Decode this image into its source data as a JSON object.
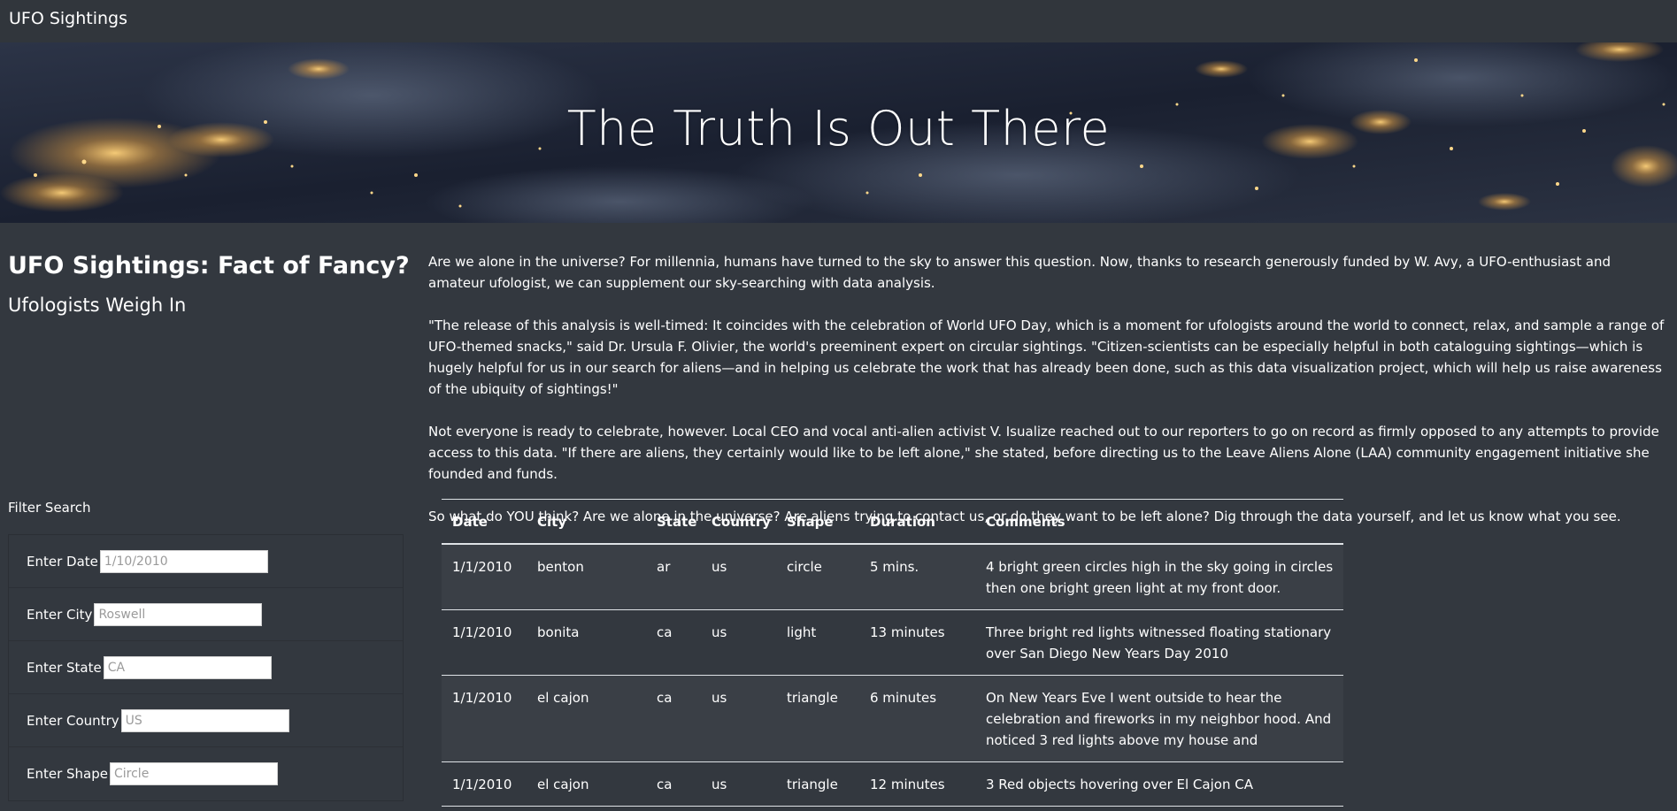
{
  "navbar": {
    "brand": "UFO Sightings"
  },
  "hero": {
    "title": "The Truth Is Out There"
  },
  "sidebar": {
    "heading": "UFO Sightings: Fact of Fancy?",
    "subheading": "Ufologists Weigh In"
  },
  "article": {
    "paragraphs": [
      "Are we alone in the universe? For millennia, humans have turned to the sky to answer this question. Now, thanks to research generously funded by W. Avy, a UFO-enthusiast and amateur ufologist, we can supplement our sky-searching with data analysis.",
      "\"The release of this analysis is well-timed: It coincides with the celebration of World UFO Day, which is a moment for ufologists around the world to connect, relax, and sample a range of UFO-themed snacks,\" said Dr. Ursula F. Olivier, the world's preeminent expert on circular sightings. \"Citizen-scientists can be especially helpful in both cataloguing sightings—which is hugely helpful for us in our search for aliens—and in helping us celebrate the work that has already been done, such as this data visualization project, which will help us raise awareness of the ubiquity of sightings!\"",
      "Not everyone is ready to celebrate, however. Local CEO and vocal anti-alien activist V. Isualize reached out to our reporters to go on record as firmly opposed to any attempts to provide access to this data. \"If there are aliens, they certainly would like to be left alone,\" she stated, before directing us to the Leave Aliens Alone (LAA) community engagement initiative she founded and funds.",
      "So what do YOU think? Are we alone in the universe? Are aliens trying to contact us, or do they want to be left alone? Dig through the data yourself, and let us know what you see."
    ]
  },
  "filter": {
    "title": "Filter Search",
    "fields": [
      {
        "label": "Enter Date",
        "placeholder": "1/10/2010",
        "value": ""
      },
      {
        "label": "Enter City",
        "placeholder": "Roswell",
        "value": ""
      },
      {
        "label": "Enter State",
        "placeholder": "CA",
        "value": ""
      },
      {
        "label": "Enter Country",
        "placeholder": "US",
        "value": ""
      },
      {
        "label": "Enter Shape",
        "placeholder": "Circle",
        "value": ""
      }
    ]
  },
  "table": {
    "headers": [
      "Date",
      "City",
      "State",
      "Country",
      "Shape",
      "Duration",
      "Comments"
    ],
    "rows": [
      [
        "1/1/2010",
        "benton",
        "ar",
        "us",
        "circle",
        "5 mins.",
        "4 bright green circles high in the sky going in circles then one bright green light at my front door."
      ],
      [
        "1/1/2010",
        "bonita",
        "ca",
        "us",
        "light",
        "13 minutes",
        "Three bright red lights witnessed floating stationary over San Diego New Years Day 2010"
      ],
      [
        "1/1/2010",
        "el cajon",
        "ca",
        "us",
        "triangle",
        "6 minutes",
        "On New Years Eve I went outside to hear the celebration and fireworks in my neighbor hood. And noticed 3 red lights above my house and"
      ],
      [
        "1/1/2010",
        "el cajon",
        "ca",
        "us",
        "triangle",
        "12 minutes",
        "3 Red objects hovering over El Cajon CA"
      ]
    ]
  },
  "colors": {
    "background": "#33383f",
    "navbar": "#31363c",
    "table_stripe": "#3a3f46",
    "table_border": "#dee2e6"
  }
}
